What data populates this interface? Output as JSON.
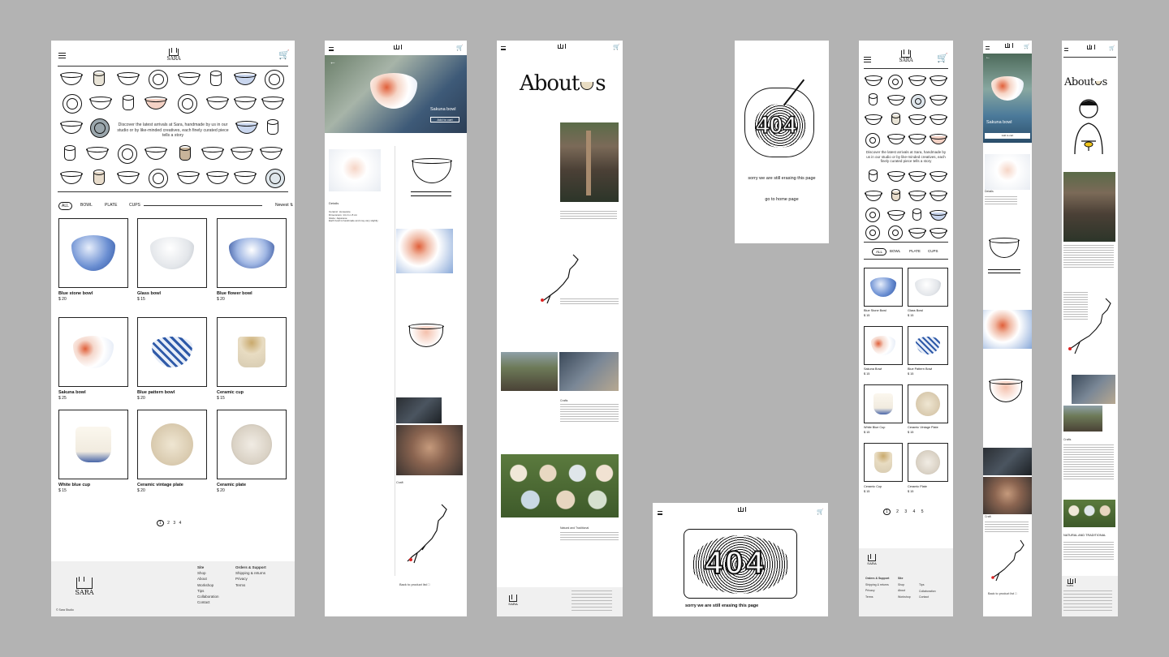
{
  "brand": {
    "logo_text": "SARA"
  },
  "home_desktop": {
    "intro": "Discover the latest arrivals at Sara, handmade by us in our studio or by like-minded creatives, each finely curated piece tells a story",
    "tabs": [
      "ALL",
      "BOWL",
      "PLATE",
      "CUPS"
    ],
    "sort_label": "Newest",
    "products": [
      {
        "name": "Blue stone bowl",
        "price": "$ 20"
      },
      {
        "name": "Glass bowl",
        "price": "$ 15"
      },
      {
        "name": "Blue flower bowl",
        "price": "$ 20"
      },
      {
        "name": "Sakuna bowl",
        "price": "$ 25"
      },
      {
        "name": "Blue pattern bowl",
        "price": "$ 20"
      },
      {
        "name": "Ceramic cup",
        "price": "$ 15"
      },
      {
        "name": "White blue cup",
        "price": "$ 15"
      },
      {
        "name": "Ceramic vintage plate",
        "price": "$ 20"
      },
      {
        "name": "Ceramic plate",
        "price": "$ 20"
      }
    ],
    "pagination": [
      "1",
      "2",
      "3",
      "4"
    ],
    "footer": {
      "col1_title": "Site",
      "col1_items": [
        "Shop",
        "About",
        "Workshop",
        "Tips",
        "Collaboration",
        "Contact"
      ],
      "col2_title": "Orders & Support",
      "col2_items": [
        "Shipping & returns",
        "Privacy",
        "Terms"
      ],
      "copyright": "© Sara Studio"
    }
  },
  "product_desktop": {
    "hero_title": "Sakuna bowl",
    "hero_button": "Add to cart",
    "details_title": "Details",
    "details_lines": [
      "Ceramic: stoneware",
      "Dimensions: 14 cm x 8 cm",
      "Glaze: Japanese",
      "Each bowl is handmade and may vary slightly"
    ],
    "craft_title": "Craft",
    "back_label": "Back to product list"
  },
  "about_desktop": {
    "title_a": "About",
    "title_b": "s",
    "story_title": "Crafts",
    "natural_title": "Natural and Traditional"
  },
  "error_desktop": {
    "code": "404",
    "message": "sorry we are still erasing this page",
    "link": "go to home page"
  },
  "error_tablet": {
    "code": "404",
    "message": "sorry we are still erasing this page"
  },
  "home_mobile": {
    "intro": "Discover the latest arrivals at Sara, handmade by us in our studio or by like-minded creatives, each finely curated piece tells a story",
    "tabs": [
      "ALL",
      "BOWL",
      "PLATE",
      "CUPS"
    ],
    "products": [
      {
        "name": "Blue Stone Bowl",
        "price": "$ 15"
      },
      {
        "name": "Glass Bowl",
        "price": "$ 15"
      },
      {
        "name": "Sakuna Bowl",
        "price": "$ 15"
      },
      {
        "name": "Blue Pattern Bowl",
        "price": "$ 15"
      },
      {
        "name": "White Blue Cup",
        "price": "$ 15"
      },
      {
        "name": "Ceramic Vintage Plate",
        "price": "$ 15"
      },
      {
        "name": "Ceramic Cup",
        "price": "$ 15"
      },
      {
        "name": "Ceramic Plate",
        "price": "$ 15"
      }
    ],
    "pagination": [
      "1",
      "2",
      "3",
      "4",
      "5"
    ],
    "footer": {
      "col1_title": "Orders & Support",
      "col1_items": [
        "Shipping & returns",
        "Privacy",
        "Terms"
      ],
      "col2_title": "Site",
      "col2_items": [
        "Shop",
        "About",
        "Workshop"
      ],
      "col3_items": [
        "Tips",
        "Collaboration",
        "Contact"
      ]
    }
  },
  "product_mobile": {
    "hero_title": "Sakuna bowl",
    "hero_button": "Add to cart",
    "details_title": "Details",
    "craft_title": "Craft",
    "back_label": "Back to product list"
  },
  "about_mobile": {
    "title_a": "About",
    "title_b": "s",
    "story_title": "Crafts",
    "natural_title": "NATURAL AND TRADITIONAL"
  },
  "colors": {
    "background": "#b3b3b3",
    "panel": "#ffffff",
    "footer": "#f0f0f0",
    "accent_blue": "#2f5aa8",
    "accent_orange": "#e0603a"
  }
}
